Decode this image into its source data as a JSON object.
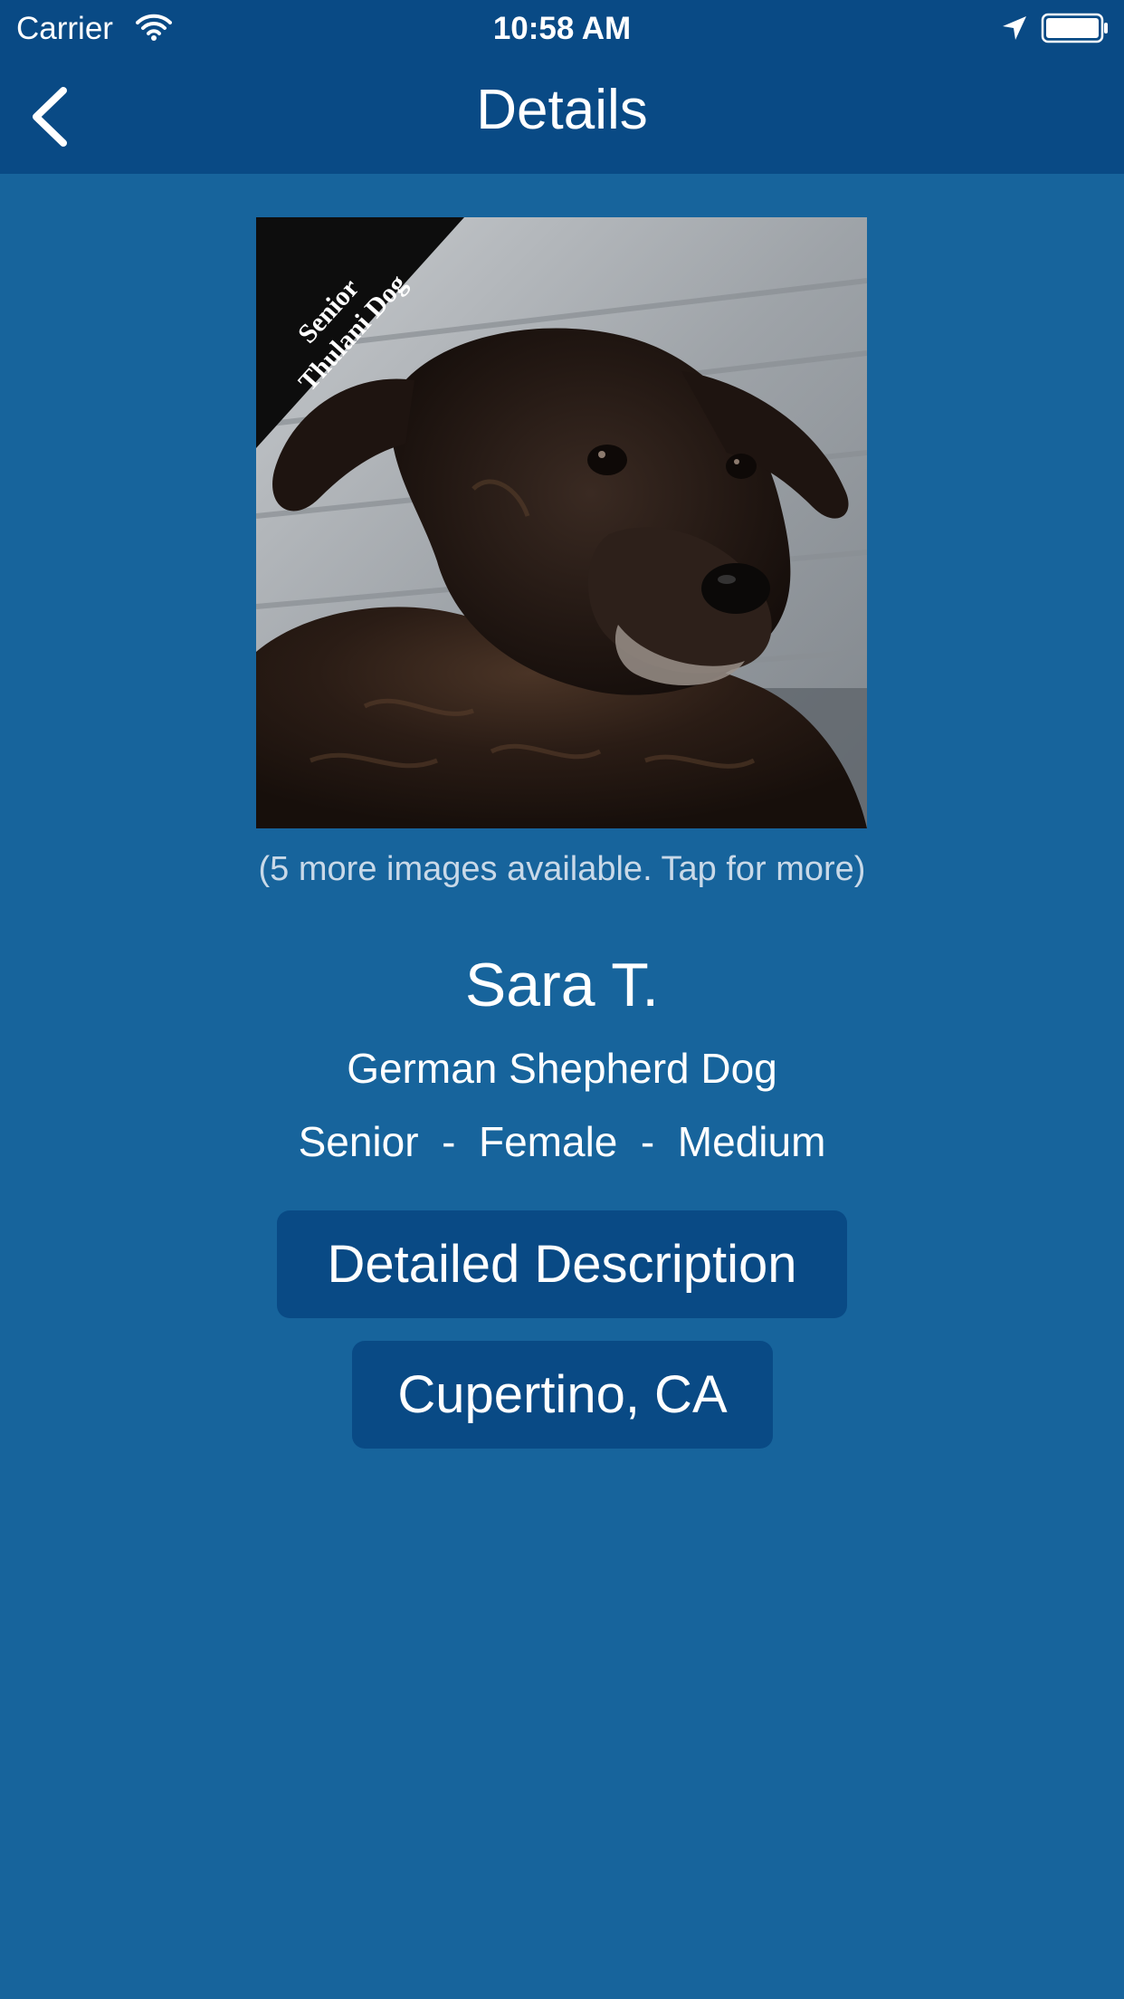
{
  "status_bar": {
    "carrier": "Carrier",
    "time": "10:58 AM",
    "icons": [
      "wifi-icon",
      "location-arrow-icon",
      "battery-icon"
    ]
  },
  "nav": {
    "back_icon": "chevron-left-icon",
    "title": "Details"
  },
  "photo": {
    "banner_line1": "Senior",
    "banner_line2": "Thulani Dog",
    "more_images_text": "(5 more images available. Tap for more)"
  },
  "pet": {
    "name": "Sara T.",
    "breed": "German Shepherd Dog",
    "attributes": "Senior  -  Female  -  Medium"
  },
  "buttons": {
    "description_label": "Detailed Description",
    "location_label": "Cupertino, CA"
  },
  "colors": {
    "background": "#17649c",
    "nav_bar": "#094a85",
    "button": "#094a85",
    "muted_text": "#c9d9e8"
  }
}
